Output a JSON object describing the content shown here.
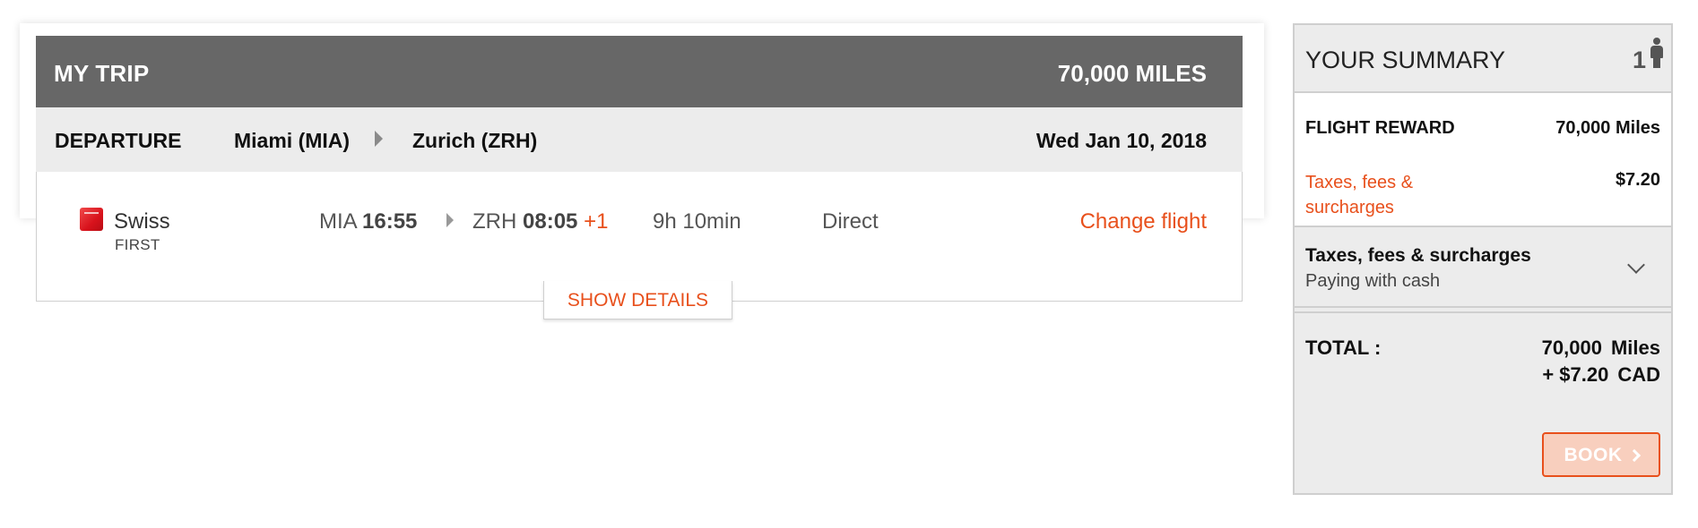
{
  "trip": {
    "title": "MY TRIP",
    "total_miles": "70,000 MILES",
    "departure_label": "DEPARTURE",
    "origin": "Miami (MIA)",
    "destination": "Zurich (ZRH)",
    "date": "Wed Jan 10, 2018",
    "flight": {
      "airline": "Swiss",
      "airline_icon": "swiss-logo-icon",
      "cabin": "FIRST",
      "dep_code": "MIA",
      "dep_time": "16:55",
      "arr_code": "ZRH",
      "arr_time": "08:05",
      "day_offset": "+1",
      "duration": "9h 10min",
      "stops": "Direct",
      "change_label": "Change flight"
    },
    "show_details_label": "SHOW DETAILS"
  },
  "summary": {
    "title": "YOUR SUMMARY",
    "passengers": "1",
    "passenger_icon": "person-icon",
    "reward_label": "FLIGHT REWARD",
    "reward_value": "70,000 Miles",
    "taxes_label": "Taxes, fees & surcharges",
    "taxes_value": "$7.20",
    "taxes_section_title": "Taxes, fees & surcharges",
    "taxes_section_sub": "Paying with cash",
    "total_label": "TOTAL :",
    "total_miles_value": "70,000",
    "total_miles_unit": "Miles",
    "total_cash_value": "+ $7.20",
    "total_cash_unit": "CAD",
    "book_label": "BOOK"
  },
  "colors": {
    "accent": "#e8501c",
    "header_bg": "#676767",
    "row_bg": "#ececec"
  }
}
